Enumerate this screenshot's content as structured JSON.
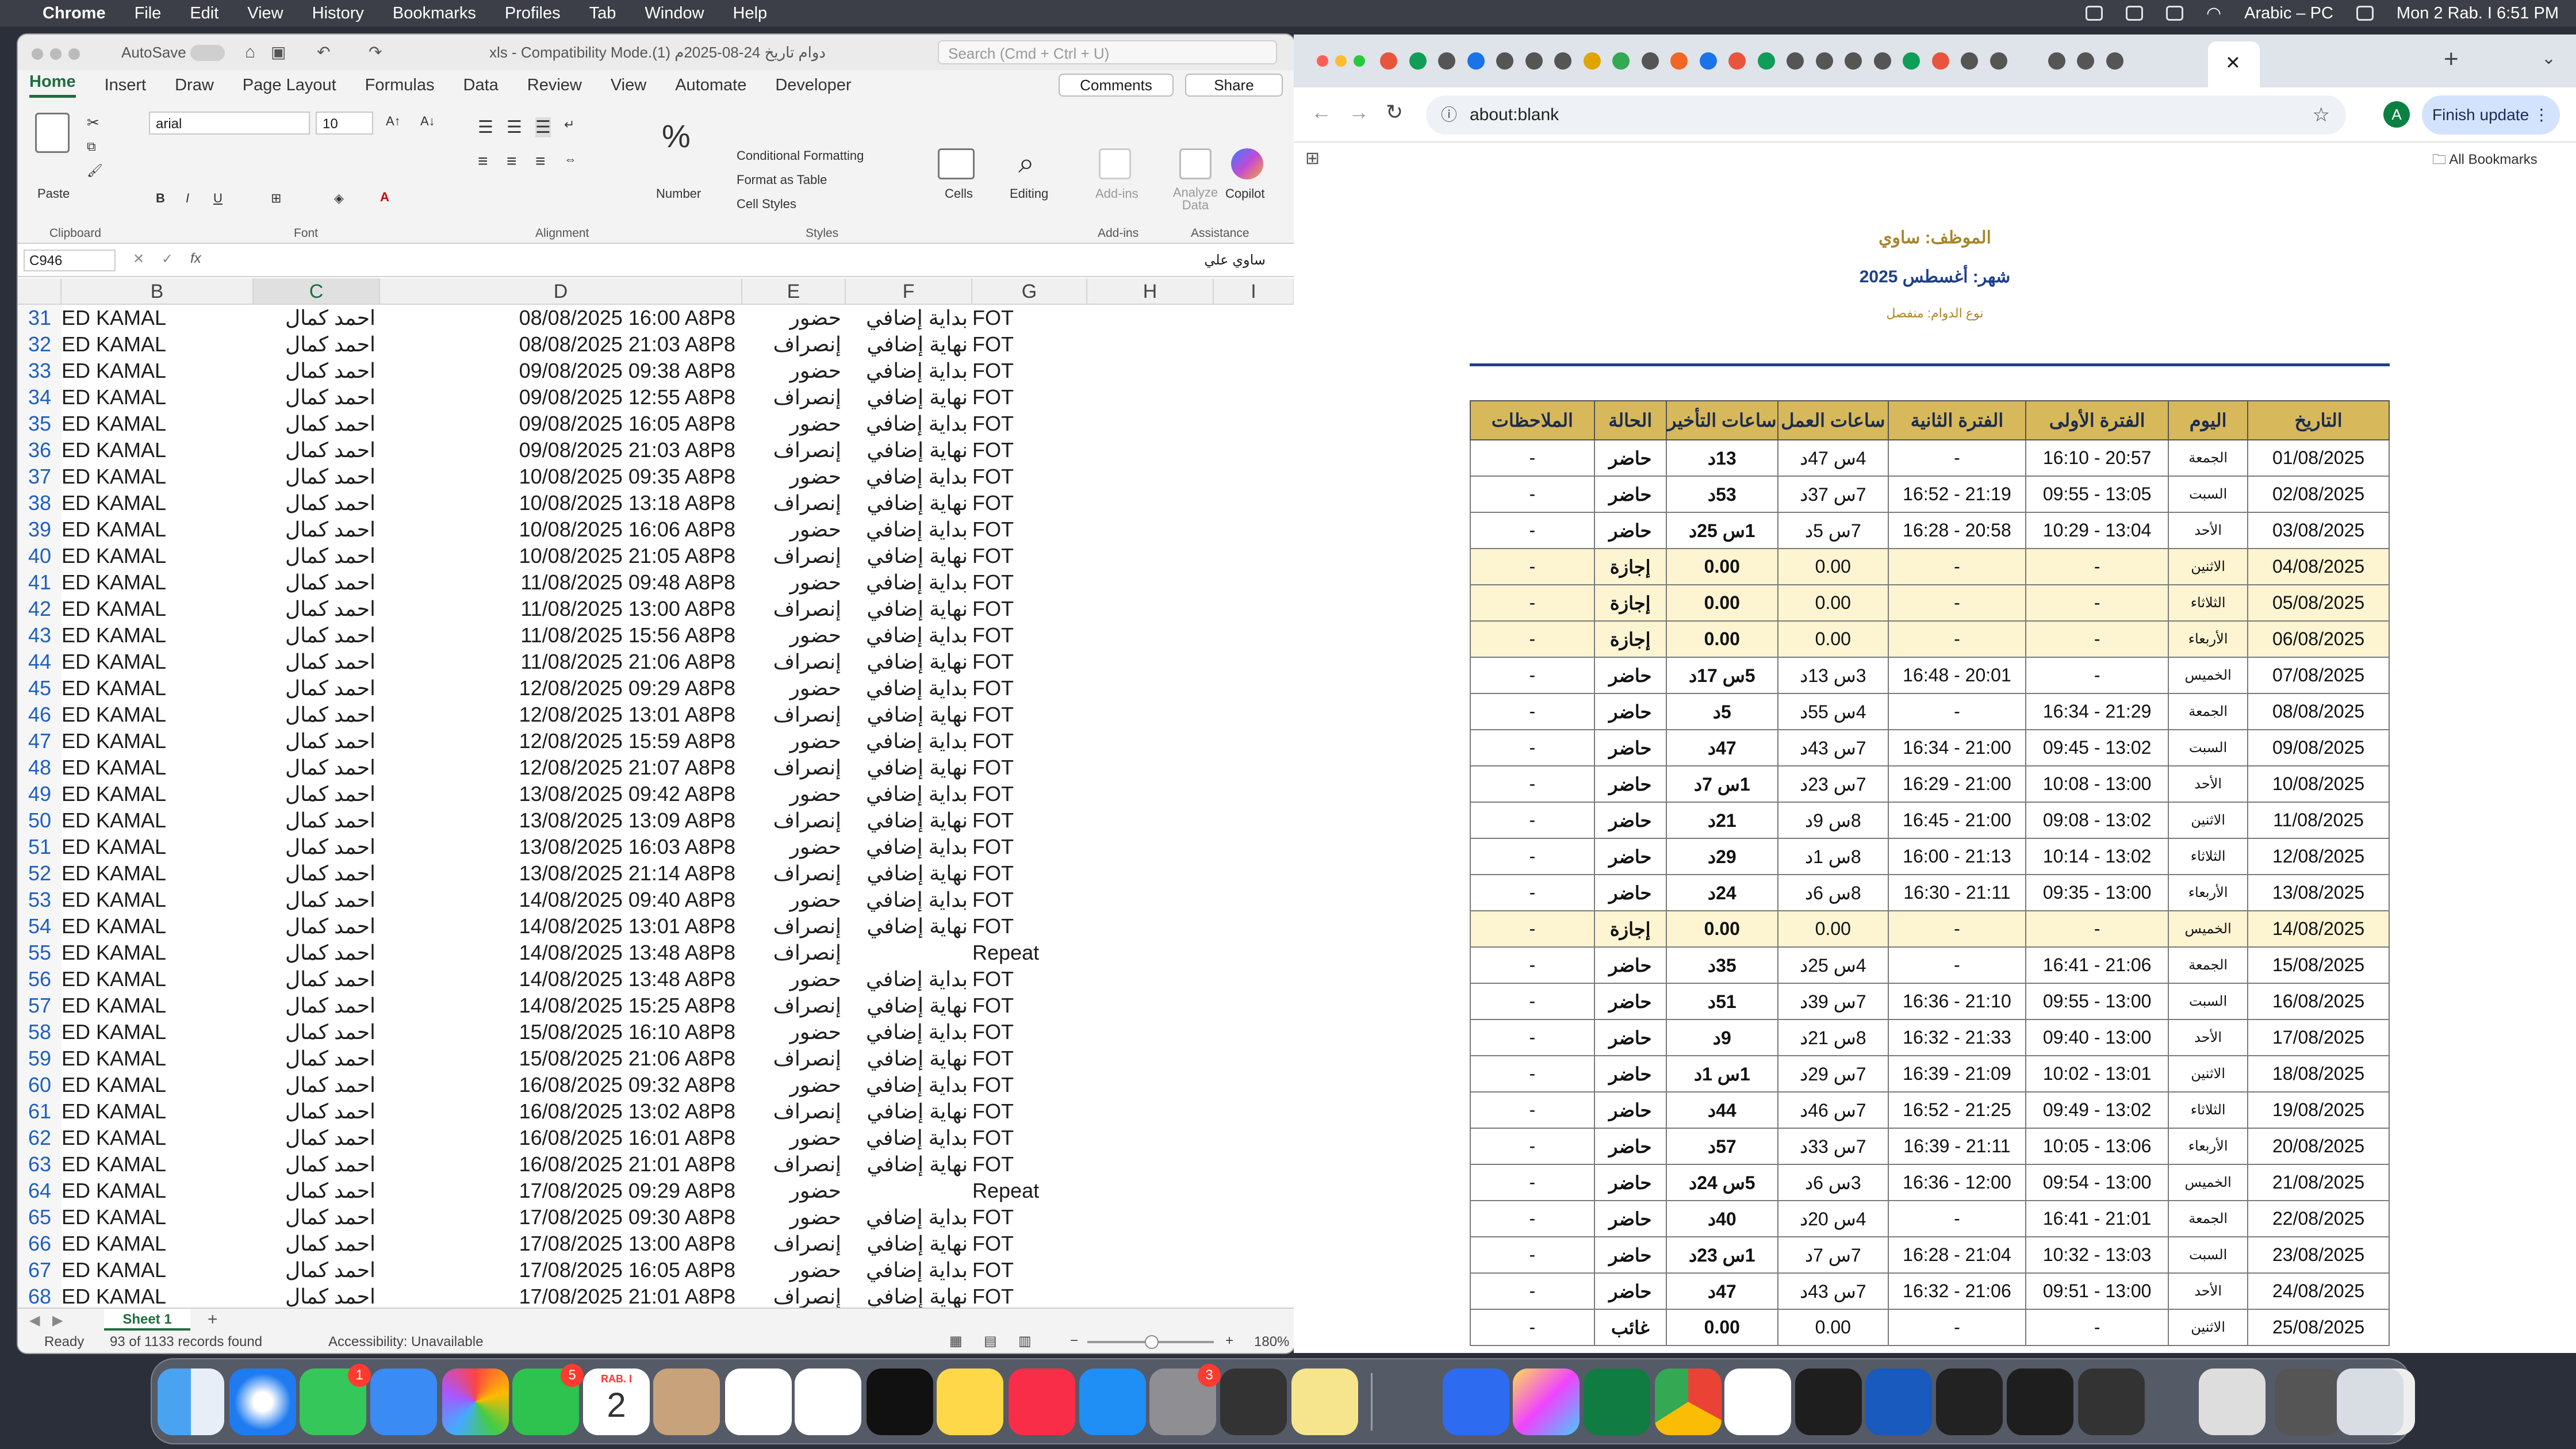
{
  "menubar": {
    "app": "Chrome",
    "items": [
      "File",
      "Edit",
      "View",
      "History",
      "Bookmarks",
      "Profiles",
      "Tab",
      "Window",
      "Help"
    ],
    "input_source": "Arabic – PC",
    "clock": "Mon 2 Rab. I 6:51 PM"
  },
  "excel": {
    "autosave_label": "AutoSave",
    "doc_title": "دوام تاريخ 24-08-2025م (1).xls - Compatibility Mode",
    "search_placeholder": "Search (Cmd + Ctrl + U)",
    "tabs": [
      "Home",
      "Insert",
      "Draw",
      "Page Layout",
      "Formulas",
      "Data",
      "Review",
      "View",
      "Automate",
      "Developer"
    ],
    "comments_label": "Comments",
    "share_label": "Share",
    "ribbon": {
      "paste": "Paste",
      "clipboard": "Clipboard",
      "font_name": "arial",
      "font_size": "10",
      "font_group": "Font",
      "alignment_group": "Alignment",
      "number": "Number",
      "conditional_formatting": "Conditional Formatting",
      "format_as_table": "Format as Table",
      "cell_styles": "Cell Styles",
      "styles_group": "Styles",
      "cells": "Cells",
      "editing": "Editing",
      "addins": "Add-ins",
      "addins_group": "Add-ins",
      "analyze_data": "Analyze Data",
      "copilot": "Copilot",
      "assistance_group": "Assistance"
    },
    "name_box": "C946",
    "formula_value": "ساوي علي",
    "fx": "fx",
    "columns": [
      "B",
      "C",
      "D",
      "E",
      "F",
      "G",
      "H",
      "I"
    ],
    "rows": [
      [
        "31",
        "ED KAMAL",
        "احمد كمال",
        "08/08/2025 16:00 A8P8",
        "حضور",
        "بداية إضافي",
        "FOT"
      ],
      [
        "32",
        "ED KAMAL",
        "احمد كمال",
        "08/08/2025 21:03 A8P8",
        "إنصراف",
        "نهاية إضافي",
        "FOT"
      ],
      [
        "33",
        "ED KAMAL",
        "احمد كمال",
        "09/08/2025 09:38 A8P8",
        "حضور",
        "بداية إضافي",
        "FOT"
      ],
      [
        "34",
        "ED KAMAL",
        "احمد كمال",
        "09/08/2025 12:55 A8P8",
        "إنصراف",
        "نهاية إضافي",
        "FOT"
      ],
      [
        "35",
        "ED KAMAL",
        "احمد كمال",
        "09/08/2025 16:05 A8P8",
        "حضور",
        "بداية إضافي",
        "FOT"
      ],
      [
        "36",
        "ED KAMAL",
        "احمد كمال",
        "09/08/2025 21:03 A8P8",
        "إنصراف",
        "نهاية إضافي",
        "FOT"
      ],
      [
        "37",
        "ED KAMAL",
        "احمد كمال",
        "10/08/2025 09:35 A8P8",
        "حضور",
        "بداية إضافي",
        "FOT"
      ],
      [
        "38",
        "ED KAMAL",
        "احمد كمال",
        "10/08/2025 13:18 A8P8",
        "إنصراف",
        "نهاية إضافي",
        "FOT"
      ],
      [
        "39",
        "ED KAMAL",
        "احمد كمال",
        "10/08/2025 16:06 A8P8",
        "حضور",
        "بداية إضافي",
        "FOT"
      ],
      [
        "40",
        "ED KAMAL",
        "احمد كمال",
        "10/08/2025 21:05 A8P8",
        "إنصراف",
        "نهاية إضافي",
        "FOT"
      ],
      [
        "41",
        "ED KAMAL",
        "احمد كمال",
        "11/08/2025 09:48 A8P8",
        "حضور",
        "بداية إضافي",
        "FOT"
      ],
      [
        "42",
        "ED KAMAL",
        "احمد كمال",
        "11/08/2025 13:00 A8P8",
        "إنصراف",
        "نهاية إضافي",
        "FOT"
      ],
      [
        "43",
        "ED KAMAL",
        "احمد كمال",
        "11/08/2025 15:56 A8P8",
        "حضور",
        "بداية إضافي",
        "FOT"
      ],
      [
        "44",
        "ED KAMAL",
        "احمد كمال",
        "11/08/2025 21:06 A8P8",
        "إنصراف",
        "نهاية إضافي",
        "FOT"
      ],
      [
        "45",
        "ED KAMAL",
        "احمد كمال",
        "12/08/2025 09:29 A8P8",
        "حضور",
        "بداية إضافي",
        "FOT"
      ],
      [
        "46",
        "ED KAMAL",
        "احمد كمال",
        "12/08/2025 13:01 A8P8",
        "إنصراف",
        "نهاية إضافي",
        "FOT"
      ],
      [
        "47",
        "ED KAMAL",
        "احمد كمال",
        "12/08/2025 15:59 A8P8",
        "حضور",
        "بداية إضافي",
        "FOT"
      ],
      [
        "48",
        "ED KAMAL",
        "احمد كمال",
        "12/08/2025 21:07 A8P8",
        "إنصراف",
        "نهاية إضافي",
        "FOT"
      ],
      [
        "49",
        "ED KAMAL",
        "احمد كمال",
        "13/08/2025 09:42 A8P8",
        "حضور",
        "بداية إضافي",
        "FOT"
      ],
      [
        "50",
        "ED KAMAL",
        "احمد كمال",
        "13/08/2025 13:09 A8P8",
        "إنصراف",
        "نهاية إضافي",
        "FOT"
      ],
      [
        "51",
        "ED KAMAL",
        "احمد كمال",
        "13/08/2025 16:03 A8P8",
        "حضور",
        "بداية إضافي",
        "FOT"
      ],
      [
        "52",
        "ED KAMAL",
        "احمد كمال",
        "13/08/2025 21:14 A8P8",
        "إنصراف",
        "نهاية إضافي",
        "FOT"
      ],
      [
        "53",
        "ED KAMAL",
        "احمد كمال",
        "14/08/2025 09:40 A8P8",
        "حضور",
        "بداية إضافي",
        "FOT"
      ],
      [
        "54",
        "ED KAMAL",
        "احمد كمال",
        "14/08/2025 13:01 A8P8",
        "إنصراف",
        "نهاية إضافي",
        "FOT"
      ],
      [
        "55",
        "ED KAMAL",
        "احمد كمال",
        "14/08/2025 13:48 A8P8",
        "إنصراف",
        "",
        "Repeat"
      ],
      [
        "56",
        "ED KAMAL",
        "احمد كمال",
        "14/08/2025 13:48 A8P8",
        "حضور",
        "بداية إضافي",
        "FOT"
      ],
      [
        "57",
        "ED KAMAL",
        "احمد كمال",
        "14/08/2025 15:25 A8P8",
        "إنصراف",
        "نهاية إضافي",
        "FOT"
      ],
      [
        "58",
        "ED KAMAL",
        "احمد كمال",
        "15/08/2025 16:10 A8P8",
        "حضور",
        "بداية إضافي",
        "FOT"
      ],
      [
        "59",
        "ED KAMAL",
        "احمد كمال",
        "15/08/2025 21:06 A8P8",
        "إنصراف",
        "نهاية إضافي",
        "FOT"
      ],
      [
        "60",
        "ED KAMAL",
        "احمد كمال",
        "16/08/2025 09:32 A8P8",
        "حضور",
        "بداية إضافي",
        "FOT"
      ],
      [
        "61",
        "ED KAMAL",
        "احمد كمال",
        "16/08/2025 13:02 A8P8",
        "إنصراف",
        "نهاية إضافي",
        "FOT"
      ],
      [
        "62",
        "ED KAMAL",
        "احمد كمال",
        "16/08/2025 16:01 A8P8",
        "حضور",
        "بداية إضافي",
        "FOT"
      ],
      [
        "63",
        "ED KAMAL",
        "احمد كمال",
        "16/08/2025 21:01 A8P8",
        "إنصراف",
        "نهاية إضافي",
        "FOT"
      ],
      [
        "64",
        "ED KAMAL",
        "احمد كمال",
        "17/08/2025 09:29 A8P8",
        "حضور",
        "",
        "Repeat"
      ],
      [
        "65",
        "ED KAMAL",
        "احمد كمال",
        "17/08/2025 09:30 A8P8",
        "حضور",
        "بداية إضافي",
        "FOT"
      ],
      [
        "66",
        "ED KAMAL",
        "احمد كمال",
        "17/08/2025 13:00 A8P8",
        "إنصراف",
        "نهاية إضافي",
        "FOT"
      ],
      [
        "67",
        "ED KAMAL",
        "احمد كمال",
        "17/08/2025 16:05 A8P8",
        "حضور",
        "بداية إضافي",
        "FOT"
      ],
      [
        "68",
        "ED KAMAL",
        "احمد كمال",
        "17/08/2025 21:01 A8P8",
        "إنصراف",
        "نهاية إضافي",
        "FOT"
      ]
    ],
    "sheet_tab": "Sheet 1",
    "status_ready": "Ready",
    "status_records": "93 of 1133 records found",
    "status_accessibility": "Accessibility: Unavailable",
    "zoom": "180%"
  },
  "chrome": {
    "address": "about:blank",
    "finish_update": "Finish update",
    "profile_initial": "A",
    "all_bookmarks": "All Bookmarks",
    "tab_count": 26
  },
  "report": {
    "employee": "الموظف: ساوي",
    "month": "شهر: أغسطس 2025",
    "shift_type": "نوع الدوام: منفصل",
    "headers": [
      "التاريخ",
      "اليوم",
      "الفترة الأولى",
      "الفترة الثانية",
      "ساعات العمل",
      "ساعات التأخير",
      "الحالة",
      "الملاحظات"
    ],
    "rows": [
      {
        "date": "01/08/2025",
        "day": "الجمعة",
        "p1": "16:10 - 20:57",
        "p2": "-",
        "hours": "4س 47د",
        "late": "13د",
        "status": "حاضر",
        "note": "-",
        "type": "p"
      },
      {
        "date": "02/08/2025",
        "day": "السبت",
        "p1": "09:55 - 13:05",
        "p2": "16:52 - 21:19",
        "hours": "7س 37د",
        "late": "53د",
        "status": "حاضر",
        "note": "-",
        "type": "p"
      },
      {
        "date": "03/08/2025",
        "day": "الأحد",
        "p1": "10:29 - 13:04",
        "p2": "16:28 - 20:58",
        "hours": "7س 5د",
        "late": "1س 25د",
        "status": "حاضر",
        "note": "-",
        "type": "p"
      },
      {
        "date": "04/08/2025",
        "day": "الاثنين",
        "p1": "-",
        "p2": "-",
        "hours": "0.00",
        "late": "0.00",
        "status": "إجازة",
        "note": "-",
        "type": "l"
      },
      {
        "date": "05/08/2025",
        "day": "الثلاثاء",
        "p1": "-",
        "p2": "-",
        "hours": "0.00",
        "late": "0.00",
        "status": "إجازة",
        "note": "-",
        "type": "l"
      },
      {
        "date": "06/08/2025",
        "day": "الأربعاء",
        "p1": "-",
        "p2": "-",
        "hours": "0.00",
        "late": "0.00",
        "status": "إجازة",
        "note": "-",
        "type": "l"
      },
      {
        "date": "07/08/2025",
        "day": "الخميس",
        "p1": "-",
        "p2": "16:48 - 20:01",
        "hours": "3س 13د",
        "late": "5س 17د",
        "status": "حاضر",
        "note": "-",
        "type": "p"
      },
      {
        "date": "08/08/2025",
        "day": "الجمعة",
        "p1": "16:34 - 21:29",
        "p2": "-",
        "hours": "4س 55د",
        "late": "5د",
        "status": "حاضر",
        "note": "-",
        "type": "p"
      },
      {
        "date": "09/08/2025",
        "day": "السبت",
        "p1": "09:45 - 13:02",
        "p2": "16:34 - 21:00",
        "hours": "7س 43د",
        "late": "47د",
        "status": "حاضر",
        "note": "-",
        "type": "p"
      },
      {
        "date": "10/08/2025",
        "day": "الأحد",
        "p1": "10:08 - 13:00",
        "p2": "16:29 - 21:00",
        "hours": "7س 23د",
        "late": "1س 7د",
        "status": "حاضر",
        "note": "-",
        "type": "p"
      },
      {
        "date": "11/08/2025",
        "day": "الاثنين",
        "p1": "09:08 - 13:02",
        "p2": "16:45 - 21:00",
        "hours": "8س 9د",
        "late": "21د",
        "status": "حاضر",
        "note": "-",
        "type": "p"
      },
      {
        "date": "12/08/2025",
        "day": "الثلاثاء",
        "p1": "10:14 - 13:02",
        "p2": "16:00 - 21:13",
        "hours": "8س 1د",
        "late": "29د",
        "status": "حاضر",
        "note": "-",
        "type": "p"
      },
      {
        "date": "13/08/2025",
        "day": "الأربعاء",
        "p1": "09:35 - 13:00",
        "p2": "16:30 - 21:11",
        "hours": "8س 6د",
        "late": "24د",
        "status": "حاضر",
        "note": "-",
        "type": "p"
      },
      {
        "date": "14/08/2025",
        "day": "الخميس",
        "p1": "-",
        "p2": "-",
        "hours": "0.00",
        "late": "0.00",
        "status": "إجازة",
        "note": "-",
        "type": "l"
      },
      {
        "date": "15/08/2025",
        "day": "الجمعة",
        "p1": "16:41 - 21:06",
        "p2": "-",
        "hours": "4س 25د",
        "late": "35د",
        "status": "حاضر",
        "note": "-",
        "type": "p"
      },
      {
        "date": "16/08/2025",
        "day": "السبت",
        "p1": "09:55 - 13:00",
        "p2": "16:36 - 21:10",
        "hours": "7س 39د",
        "late": "51د",
        "status": "حاضر",
        "note": "-",
        "type": "p"
      },
      {
        "date": "17/08/2025",
        "day": "الأحد",
        "p1": "09:40 - 13:00",
        "p2": "16:32 - 21:33",
        "hours": "8س 21د",
        "late": "9د",
        "status": "حاضر",
        "note": "-",
        "type": "p"
      },
      {
        "date": "18/08/2025",
        "day": "الاثنين",
        "p1": "10:02 - 13:01",
        "p2": "16:39 - 21:09",
        "hours": "7س 29د",
        "late": "1س 1د",
        "status": "حاضر",
        "note": "-",
        "type": "p"
      },
      {
        "date": "19/08/2025",
        "day": "الثلاثاء",
        "p1": "09:49 - 13:02",
        "p2": "16:52 - 21:25",
        "hours": "7س 46د",
        "late": "44د",
        "status": "حاضر",
        "note": "-",
        "type": "p"
      },
      {
        "date": "20/08/2025",
        "day": "الأربعاء",
        "p1": "10:05 - 13:06",
        "p2": "16:39 - 21:11",
        "hours": "7س 33د",
        "late": "57د",
        "status": "حاضر",
        "note": "-",
        "type": "p"
      },
      {
        "date": "21/08/2025",
        "day": "الخميس",
        "p1": "09:54 - 13:00",
        "p2": "16:36 - 12:00",
        "hours": "3س 6د",
        "late": "5س 24د",
        "status": "حاضر",
        "note": "-",
        "type": "p"
      },
      {
        "date": "22/08/2025",
        "day": "الجمعة",
        "p1": "16:41 - 21:01",
        "p2": "-",
        "hours": "4س 20د",
        "late": "40د",
        "status": "حاضر",
        "note": "-",
        "type": "p"
      },
      {
        "date": "23/08/2025",
        "day": "السبت",
        "p1": "10:32 - 13:03",
        "p2": "16:28 - 21:04",
        "hours": "7س 7د",
        "late": "1س 23د",
        "status": "حاضر",
        "note": "-",
        "type": "p"
      },
      {
        "date": "24/08/2025",
        "day": "الأحد",
        "p1": "09:51 - 13:00",
        "p2": "16:32 - 21:06",
        "hours": "7س 43د",
        "late": "47د",
        "status": "حاضر",
        "note": "-",
        "type": "p"
      },
      {
        "date": "25/08/2025",
        "day": "الاثنين",
        "p1": "-",
        "p2": "-",
        "hours": "0.00",
        "late": "0.00",
        "status": "غائب",
        "note": "-",
        "type": "a"
      }
    ]
  },
  "dock": {
    "calendar_month": "RAB. I",
    "calendar_day": "2",
    "messages_badge": "1",
    "facetime_badge": "5",
    "settings_badge": "3"
  }
}
